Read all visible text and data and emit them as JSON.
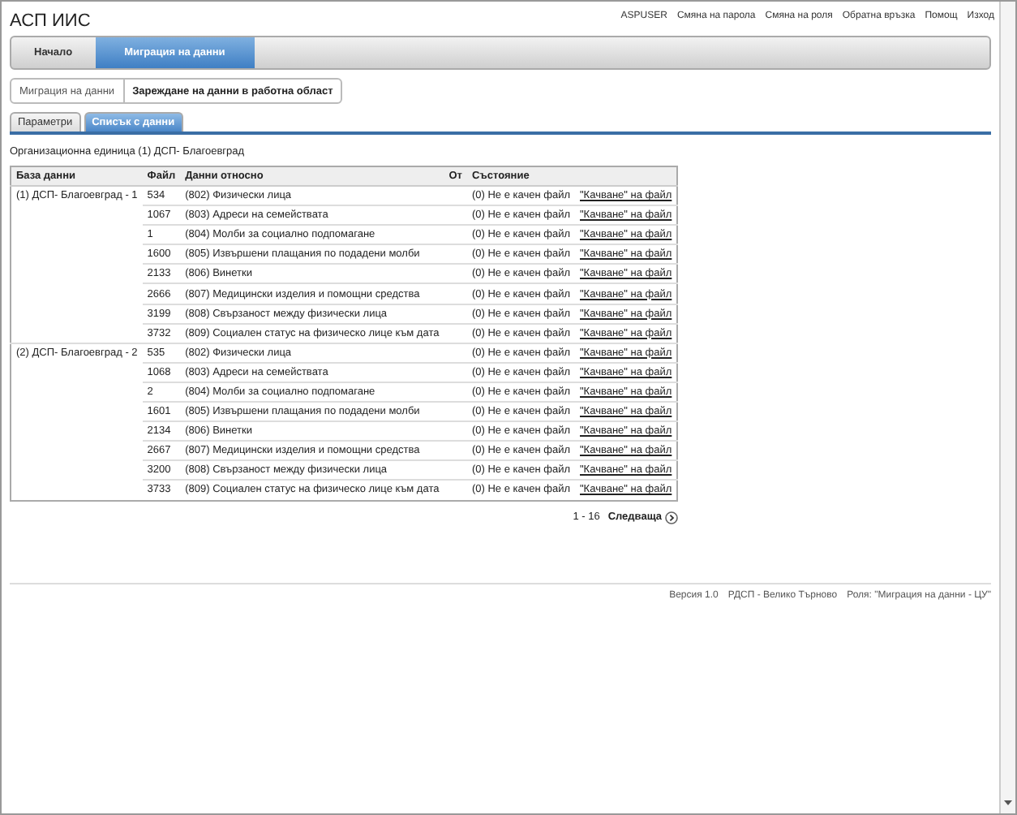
{
  "app_title": "АСП ИИС",
  "top_links": [
    "ASPUSER",
    "Смяна на парола",
    "Смяна на роля",
    "Обратна връзка",
    "Помощ",
    "Изход"
  ],
  "nav": [
    {
      "label": "Начало",
      "selected": false
    },
    {
      "label": "Миграция на данни",
      "selected": true
    }
  ],
  "breadcrumb": [
    "Миграция на данни",
    "Зареждане на данни в работна област"
  ],
  "tabs": [
    {
      "label": "Параметри",
      "selected": false
    },
    {
      "label": "Списък с данни",
      "selected": true
    }
  ],
  "org_unit": "Организационна единица (1) ДСП- Благоевград",
  "table": {
    "columns": [
      "База данни",
      "Файл",
      "Данни относно",
      "От",
      "Състояние",
      ""
    ],
    "rows": [
      {
        "database": "(1) ДСП- Благоевград - 1",
        "file": "534",
        "about": "(802) Физически лица",
        "status": "(0) Не е качен файл",
        "action": "\"Качване\" на файл"
      },
      {
        "file": "1067",
        "about": "(803) Адреси на семействата",
        "status": "(0) Не е качен файл",
        "action": "\"Качване\" на файл"
      },
      {
        "file": "1",
        "about": "(804) Молби за социално подпомагане",
        "status": "(0) Не е качен файл",
        "action": "\"Качване\" на файл"
      },
      {
        "file": "1600",
        "about": "(805) Извършени плащания по подадени молби",
        "status": "(0) Не е качен файл",
        "action": "\"Качване\" на файл"
      },
      {
        "file": "2133",
        "about": "(806) Винетки",
        "status": "(0) Не е качен файл",
        "action": "\"Качване\" на файл"
      },
      {
        "file": "2666",
        "about": "(807) Медицински изделия и помощни средства",
        "status": "(0) Не е качен файл",
        "action": "\"Качване\" на файл"
      },
      {
        "file": "3199",
        "about": "(808) Свързаност между физически лица",
        "status": "(0) Не е качен файл",
        "action": "\"Качване\" на файл"
      },
      {
        "file": "3732",
        "about": "(809) Социален статус на физическо лице към дата",
        "status": "(0) Не е качен файл",
        "action": "\"Качване\" на файл"
      },
      {
        "database": "(2) ДСП- Благоевград - 2",
        "file": "535",
        "about": "(802) Физически лица",
        "status": "(0) Не е качен файл",
        "action": "\"Качване\" на файл"
      },
      {
        "file": "1068",
        "about": "(803) Адреси на семействата",
        "status": "(0) Не е качен файл",
        "action": "\"Качване\" на файл"
      },
      {
        "file": "2",
        "about": "(804) Молби за социално подпомагане",
        "status": "(0) Не е качен файл",
        "action": "\"Качване\" на файл"
      },
      {
        "file": "1601",
        "about": "(805) Извършени плащания по подадени молби",
        "status": "(0) Не е качен файл",
        "action": "\"Качване\" на файл"
      },
      {
        "file": "2134",
        "about": "(806) Винетки",
        "status": "(0) Не е качен файл",
        "action": "\"Качване\" на файл"
      },
      {
        "file": "2667",
        "about": "(807) Медицински изделия и помощни средства",
        "status": "(0) Не е качен файл",
        "action": "\"Качване\" на файл"
      },
      {
        "file": "3200",
        "about": "(808) Свързаност между физически лица",
        "status": "(0) Не е качен файл",
        "action": "\"Качване\" на файл"
      },
      {
        "file": "3733",
        "about": "(809) Социален статус на физическо лице към дата",
        "status": "(0) Не е качен файл",
        "action": "\"Качване\" на файл"
      }
    ]
  },
  "pager": {
    "range": "1 - 16",
    "next": "Следваща"
  },
  "footer": [
    "Версия 1.0",
    "РДСП - Велико Търново",
    "Роля: \"Миграция на данни - ЦУ\""
  ]
}
